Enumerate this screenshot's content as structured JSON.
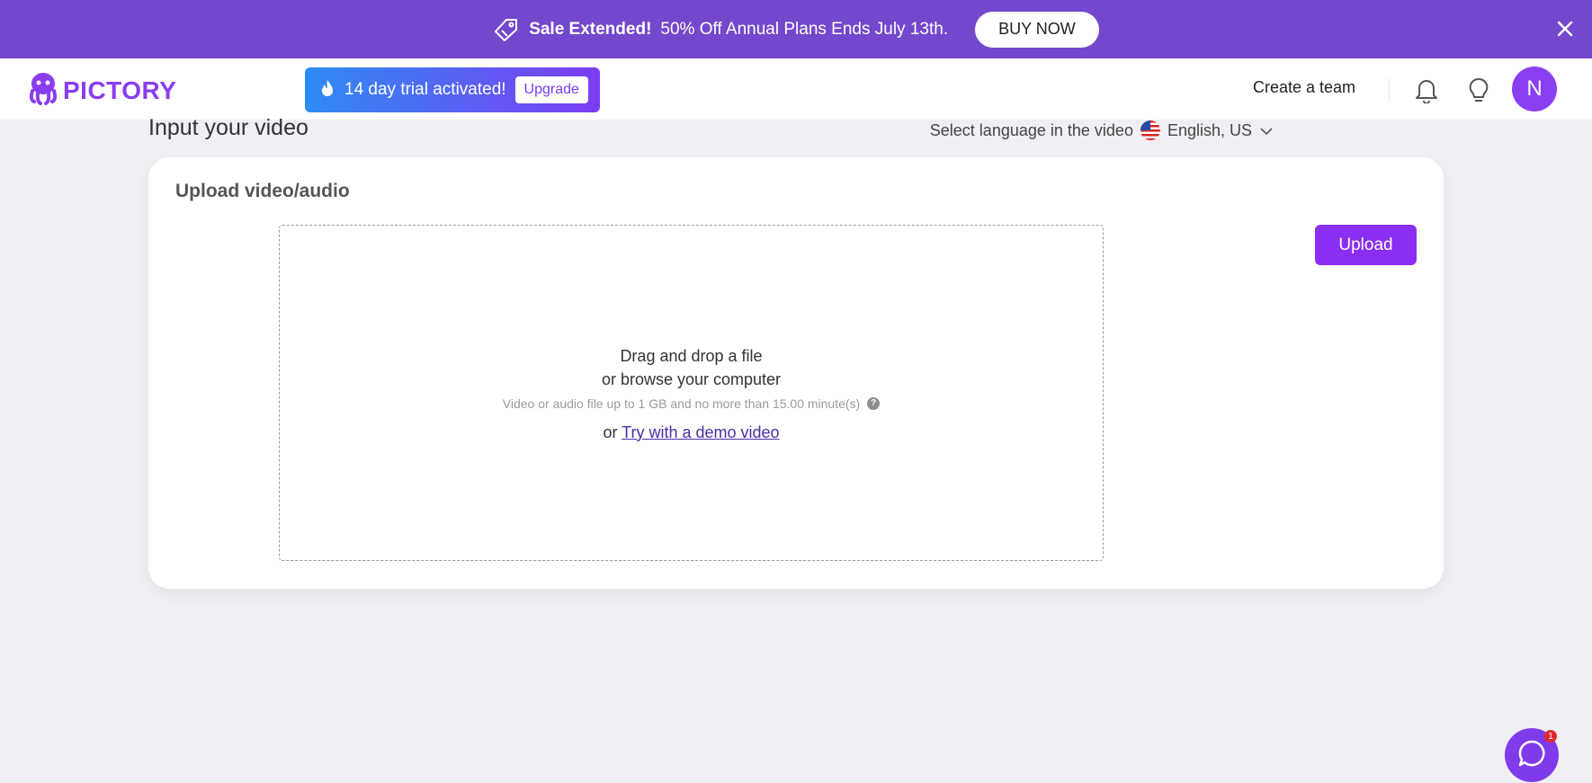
{
  "promo": {
    "strong": "Sale Extended!",
    "text": "50% Off Annual Plans Ends July 13th.",
    "buy_label": "BUY NOW"
  },
  "header": {
    "logo_text": "PICTORY",
    "trial_text": "14 day trial activated!",
    "upgrade_label": "Upgrade",
    "create_team": "Create a team",
    "avatar_initial": "N"
  },
  "main": {
    "title": "Input your video",
    "language_label": "Select language in the video",
    "language_value": "English, US",
    "card_title": "Upload video/audio",
    "upload_label": "Upload",
    "drop_line1": "Drag and drop a file",
    "drop_line2": "or browse your computer",
    "hint": "Video or audio file up to 1 GB and no more than 15.00 minute(s)",
    "or_text": "or",
    "demo_link": "Try with a demo video"
  },
  "chat": {
    "badge": "1"
  },
  "colors": {
    "promo_bg": "#7448cc",
    "accent": "#8a2ff2",
    "link": "#4a2ea6"
  }
}
